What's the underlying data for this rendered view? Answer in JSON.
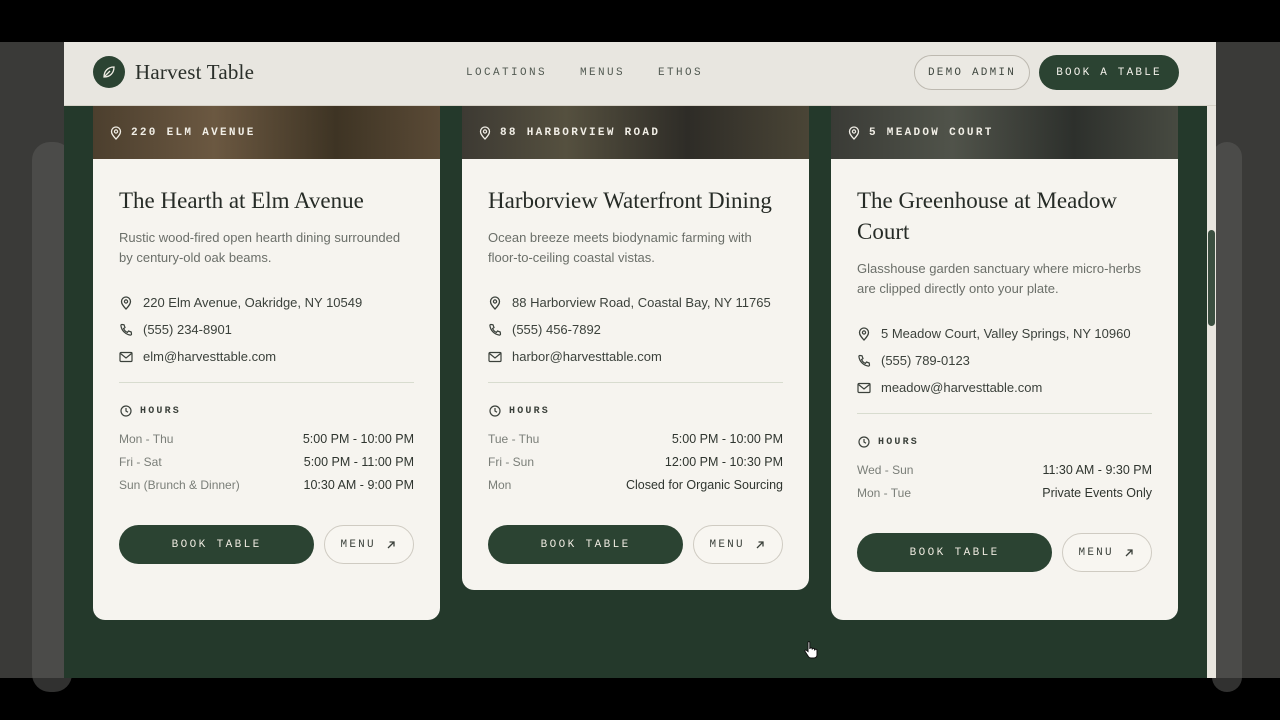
{
  "brand": {
    "name": "Harvest Table",
    "icon": "leaf-icon"
  },
  "nav": {
    "links": [
      "LOCATIONS",
      "MENUS",
      "ETHOS"
    ],
    "demo_admin": "DEMO ADMIN",
    "book_table": "BOOK A TABLE"
  },
  "colors": {
    "forest": "#2b4332",
    "cream": "#f6f4ef",
    "background": "#24392b"
  },
  "cards": [
    {
      "photo_label": "220 ELM AVENUE",
      "title": "The Hearth at Elm Avenue",
      "description": "Rustic wood-fired open hearth dining surrounded by century-old oak beams.",
      "address": "220 Elm Avenue, Oakridge, NY 10549",
      "phone": "(555) 234-8901",
      "email": "elm@harvesttable.com",
      "hours_label": "HOURS",
      "hours": [
        {
          "day": "Mon - Thu",
          "time": "5:00 PM - 10:00 PM"
        },
        {
          "day": "Fri - Sat",
          "time": "5:00 PM - 11:00 PM"
        },
        {
          "day": "Sun (Brunch & Dinner)",
          "time": "10:30 AM - 9:00 PM"
        }
      ],
      "book_label": "BOOK TABLE",
      "menu_label": "MENU"
    },
    {
      "photo_label": "88 HARBORVIEW ROAD",
      "title": "Harborview Waterfront Dining",
      "description": "Ocean breeze meets biodynamic farming with floor-to-ceiling coastal vistas.",
      "address": "88 Harborview Road, Coastal Bay, NY 11765",
      "phone": "(555) 456-7892",
      "email": "harbor@harvesttable.com",
      "hours_label": "HOURS",
      "hours": [
        {
          "day": "Tue - Thu",
          "time": "5:00 PM - 10:00 PM"
        },
        {
          "day": "Fri - Sun",
          "time": "12:00 PM - 10:30 PM"
        },
        {
          "day": "Mon",
          "time": "Closed for Organic Sourcing"
        }
      ],
      "book_label": "BOOK TABLE",
      "menu_label": "MENU"
    },
    {
      "photo_label": "5 MEADOW COURT",
      "title": "The Greenhouse at Meadow Court",
      "description": "Glasshouse garden sanctuary where micro-herbs are clipped directly onto your plate.",
      "address": "5 Meadow Court, Valley Springs, NY 10960",
      "phone": "(555) 789-0123",
      "email": "meadow@harvesttable.com",
      "hours_label": "HOURS",
      "hours": [
        {
          "day": "Wed - Sun",
          "time": "11:30 AM - 9:30 PM"
        },
        {
          "day": "Mon - Tue",
          "time": "Private Events Only"
        }
      ],
      "book_label": "BOOK TABLE",
      "menu_label": "MENU"
    }
  ]
}
